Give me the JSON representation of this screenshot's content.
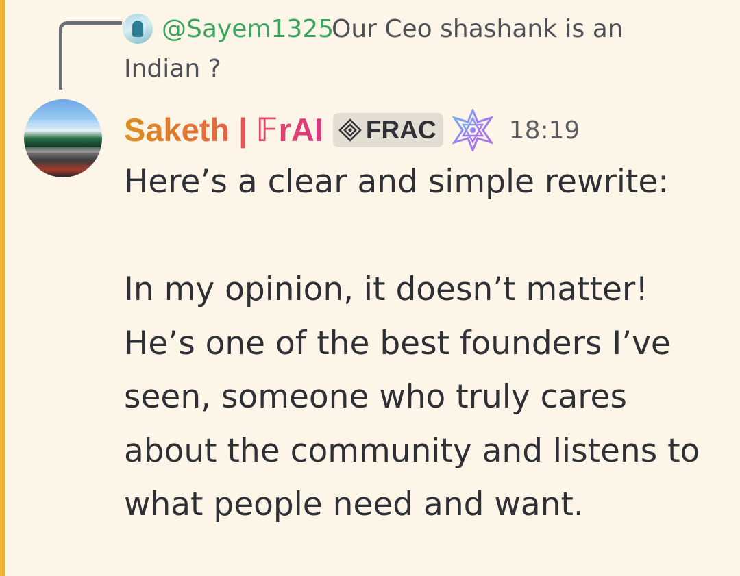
{
  "colors": {
    "background": "#fcf5e8",
    "highlight_bar": "#f0b232",
    "mention": "#3aa55d",
    "text": "#2e3035",
    "muted_text": "#4e5058",
    "timestamp": "#5c5e66"
  },
  "reply": {
    "avatar_icon": "user-avatar-icon",
    "mention": "@Sayem1325",
    "line1": "Our Ceo shashank is an",
    "line2": "Indian ?"
  },
  "message": {
    "avatar_icon": "user-avatar-icon",
    "username": "Saketh | 𝔽rAI",
    "server_tag": {
      "icon": "diamond-tag-icon",
      "label": "FRAC"
    },
    "role_icon": "star-badge-icon",
    "timestamp": "18:19",
    "lines": [
      "Here’s a clear and simple rewrite:",
      "",
      "In my opinion, it doesn’t matter!",
      "He’s one of the best founders I’ve",
      "seen, someone who truly cares",
      "about the community and listens to",
      "what people need and want."
    ]
  }
}
